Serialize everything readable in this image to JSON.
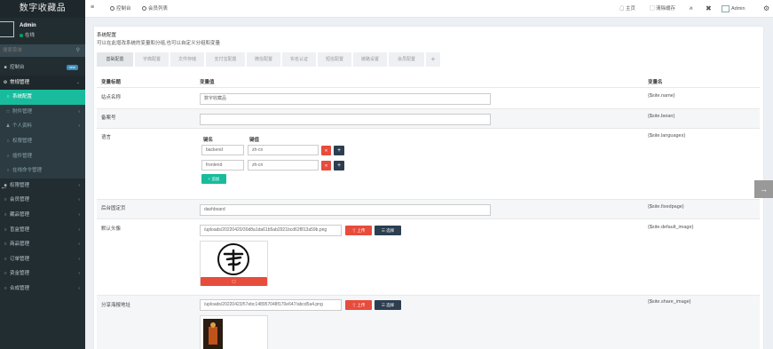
{
  "app": {
    "brand": "数字收藏品"
  },
  "user": {
    "name": "Admin",
    "status": "在线"
  },
  "sidebar": {
    "search_placeholder": "搜索菜单",
    "items": [
      {
        "label": "控制台",
        "icon": "dashboard-icon",
        "badge": "new"
      },
      {
        "label": "常规管理",
        "icon": "gear-icon"
      },
      {
        "label": "系统配置",
        "icon": "circle-icon"
      },
      {
        "label": "附件管理",
        "icon": "file-icon"
      },
      {
        "label": "个人资料",
        "icon": "user-icon"
      },
      {
        "label": "权限管理",
        "icon": "group-icon"
      },
      {
        "label": "插件管理",
        "icon": "rocket-icon"
      },
      {
        "label": "在线命令管理",
        "icon": "terminal-icon"
      },
      {
        "label": "权限管理",
        "icon": "group-icon"
      },
      {
        "label": "会员管理",
        "icon": "circle-icon"
      },
      {
        "label": "藏品管理",
        "icon": "circle-icon"
      },
      {
        "label": "盲盒管理",
        "icon": "circle-icon"
      },
      {
        "label": "商品管理",
        "icon": "circle-icon"
      },
      {
        "label": "订单管理",
        "icon": "circle-icon"
      },
      {
        "label": "资金管理",
        "icon": "circle-icon"
      },
      {
        "label": "合成管理",
        "icon": "circle-icon"
      }
    ]
  },
  "topbar": {
    "tabs": [
      "控制台",
      "会员列表"
    ],
    "home": "主页",
    "clear_cache": "清除缓存",
    "admin": "Admin"
  },
  "panel": {
    "title": "系统配置",
    "desc": "可以在此增改系统的变量和分组,也可以自定义分组和变量"
  },
  "config_tabs": [
    "基础配置",
    "字典配置",
    "文件存储",
    "支付宝配置",
    "微信配置",
    "实名认证",
    "短信配置",
    "链路设置",
    "会员配置"
  ],
  "table": {
    "headers": {
      "title": "变量标题",
      "value": "变量值",
      "name": "变量名"
    },
    "rows": [
      {
        "label": "站点名称",
        "value": "数字收藏品",
        "var": "{$site.name}"
      },
      {
        "label": "备案号",
        "value": "",
        "var": "{$site.beian}"
      },
      {
        "label": "语言",
        "var": "{$site.languages}",
        "key_label": "键名",
        "val_label": "键值",
        "pairs": [
          {
            "k": "backend",
            "v": "zh-cn"
          },
          {
            "k": "frontend",
            "v": "zh-cn"
          }
        ],
        "add_label": "+ 追加"
      },
      {
        "label": "后台固定页",
        "value": "dashboard",
        "var": "{$site.fixedpage}"
      },
      {
        "label": "默认头像",
        "value": "/uploads/20220420/30d8a1da61b5ab2921bcd62f813a59b.png",
        "var": "{$site.default_image}",
        "upload": "上传",
        "choose": "选择"
      },
      {
        "label": "分享海报地址",
        "value": "/uploads/20220423/57ebc148957048f170e647/abcd5a4.png",
        "var": "{$site.share_image}",
        "upload": "上传",
        "choose": "选择"
      }
    ]
  },
  "colors": {
    "sidebar": "#222d32",
    "active": "#18bc9c",
    "red": "#e74c3c",
    "dark": "#2c3e50"
  }
}
